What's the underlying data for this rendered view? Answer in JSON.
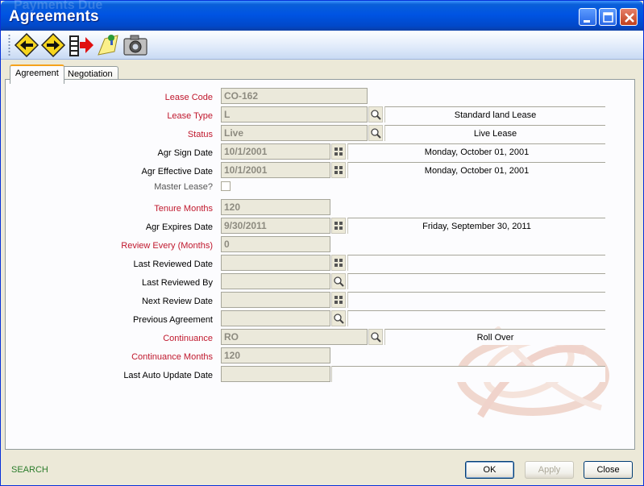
{
  "window": {
    "title": "Agreements",
    "ghost_title": "Payments Due"
  },
  "toolbar": {
    "icons": [
      "back-arrow-icon",
      "forward-arrow-icon",
      "exit-icon",
      "notes-icon",
      "camera-icon"
    ]
  },
  "tabs": [
    "Agreement",
    "Negotiation"
  ],
  "form": {
    "lease_code": {
      "label": "Lease Code",
      "value": "CO-162"
    },
    "lease_type": {
      "label": "Lease Type",
      "value": "L",
      "description": "Standard land Lease"
    },
    "status": {
      "label": "Status",
      "value": "Live",
      "description": "Live Lease"
    },
    "agr_sign_date": {
      "label": "Agr Sign Date",
      "value": "10/1/2001",
      "description": "Monday, October 01, 2001"
    },
    "agr_effective_date": {
      "label": "Agr Effective Date",
      "value": "10/1/2001",
      "description": "Monday, October 01, 2001"
    },
    "master_lease": {
      "label": "Master Lease?"
    },
    "tenure_months": {
      "label": "Tenure Months",
      "value": "120"
    },
    "agr_expires_date": {
      "label": "Agr Expires Date",
      "value": "9/30/2011",
      "description": "Friday, September 30, 2011"
    },
    "review_every": {
      "label": "Review Every (Months)",
      "value": "0"
    },
    "last_reviewed_date": {
      "label": "Last Reviewed Date",
      "value": ""
    },
    "last_reviewed_by": {
      "label": "Last Reviewed By",
      "value": ""
    },
    "next_review_date": {
      "label": "Next Review Date",
      "value": ""
    },
    "previous_agreement": {
      "label": "Previous Agreement",
      "value": ""
    },
    "continuance": {
      "label": "Continuance",
      "value": "RO",
      "description": "Roll Over"
    },
    "continuance_months": {
      "label": "Continuance Months",
      "value": "120"
    },
    "last_auto_update_date": {
      "label": "Last Auto Update Date",
      "value": ""
    }
  },
  "statusbar": {
    "text": "SEARCH"
  },
  "buttons": {
    "ok": "OK",
    "apply": "Apply",
    "close": "Close"
  },
  "colors": {
    "required_label": "#c0182d",
    "titlebar": "#0054e3",
    "status_text": "#2a7c2a"
  }
}
